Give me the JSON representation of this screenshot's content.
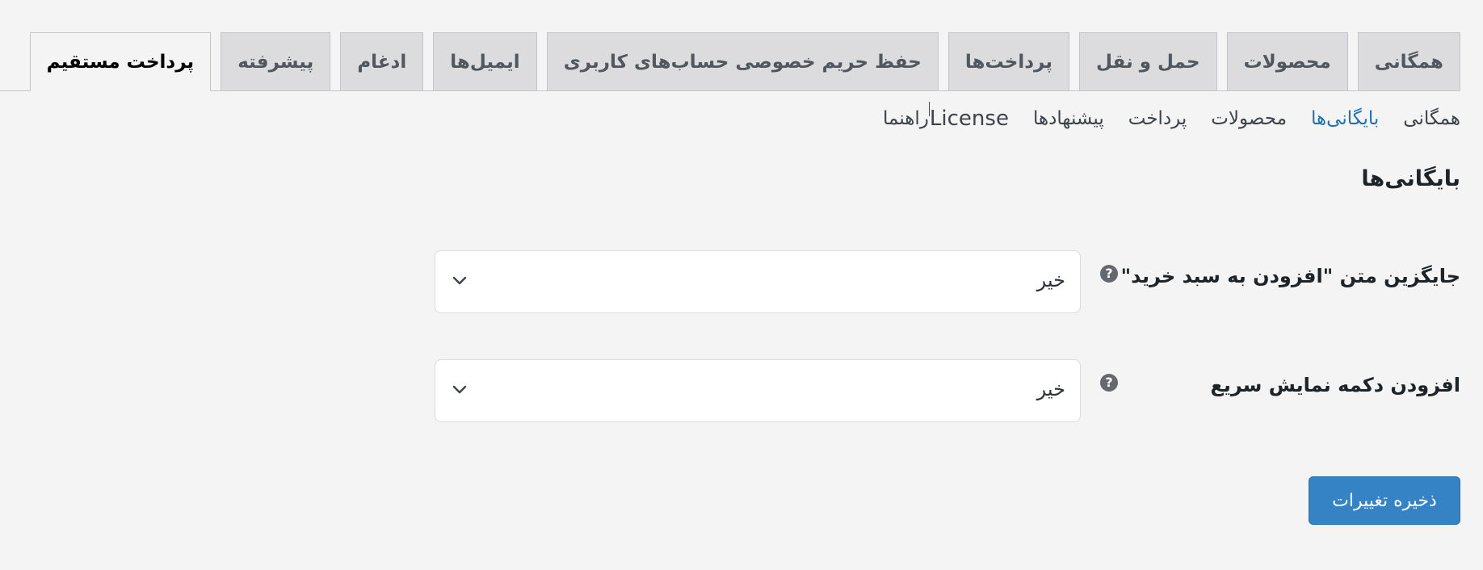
{
  "tabs": [
    {
      "label": "همگانی",
      "active": false
    },
    {
      "label": "محصولات",
      "active": false
    },
    {
      "label": "حمل و نقل",
      "active": false
    },
    {
      "label": "پرداخت‌ها",
      "active": false
    },
    {
      "label": "حفظ حریم خصوصی حساب‌های کاربری",
      "active": false
    },
    {
      "label": "ایمیل‌ها",
      "active": false
    },
    {
      "label": "ادغام",
      "active": false
    },
    {
      "label": "پیشرفته",
      "active": false
    },
    {
      "label": "پرداخت مستقیم",
      "active": true
    }
  ],
  "subnav": [
    {
      "label": "همگانی",
      "current": false
    },
    {
      "label": "بایگانی‌ها",
      "current": true
    },
    {
      "label": "محصولات",
      "current": false
    },
    {
      "label": "پرداخت",
      "current": false
    },
    {
      "label": "پیشنهادها",
      "current": false
    },
    {
      "label": "License",
      "current": false
    },
    {
      "label": "راهنما",
      "current": false
    }
  ],
  "section": {
    "title": "بایگانی‌ها"
  },
  "fields": [
    {
      "label": "جایگزین متن \"افزودن به سبد خرید\"",
      "value": "خیر",
      "help": "?"
    },
    {
      "label": "افزودن دکمه نمایش سریع",
      "value": "خیر",
      "help": "?"
    }
  ],
  "actions": {
    "save_label": "ذخیره تغییرات"
  },
  "colors": {
    "accent": "#2271b1",
    "button": "#3582c4",
    "background": "#f4f4f4",
    "tab_inactive": "#dcdcde"
  }
}
